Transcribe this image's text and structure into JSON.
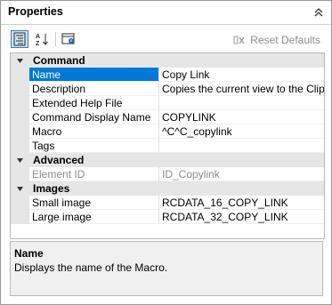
{
  "panel": {
    "title": "Properties"
  },
  "toolbar": {
    "reset_label": "Reset Defaults"
  },
  "categories": [
    {
      "label": "Command",
      "rows": [
        {
          "name": "Name",
          "value": "Copy Link",
          "selected": true
        },
        {
          "name": "Description",
          "value": "Copies the current view to the Clipboard"
        },
        {
          "name": "Extended Help File",
          "value": ""
        },
        {
          "name": "Command Display Name",
          "value": "COPYLINK"
        },
        {
          "name": "Macro",
          "value": "^C^C_copylink"
        },
        {
          "name": "Tags",
          "value": ""
        }
      ]
    },
    {
      "label": "Advanced",
      "rows": [
        {
          "name": "Element ID",
          "value": "ID_Copylink",
          "disabled": true
        }
      ]
    },
    {
      "label": "Images",
      "rows": [
        {
          "name": "Small image",
          "value": "RCDATA_16_COPY_LINK"
        },
        {
          "name": "Large image",
          "value": "RCDATA_32_COPY_LINK"
        }
      ]
    }
  ],
  "description": {
    "title": "Name",
    "text": "Displays the name of the Macro."
  }
}
